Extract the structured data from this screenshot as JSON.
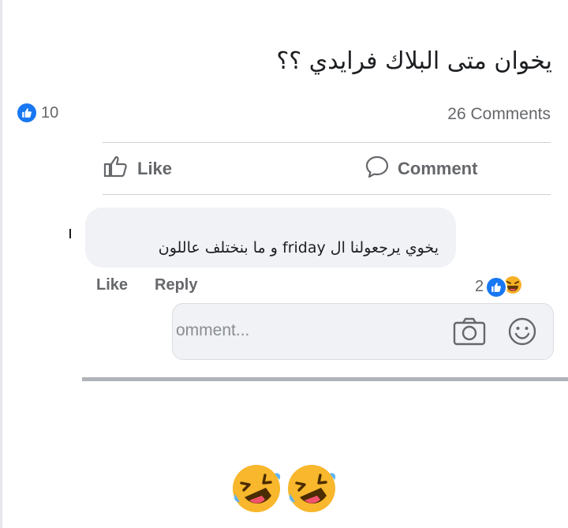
{
  "post": {
    "text": "يخوان متى البلاك فرايدي ؟؟"
  },
  "stats": {
    "reaction_count": "10",
    "comments_label": "26 Comments"
  },
  "actions": {
    "like_label": "Like",
    "comment_label": "Comment"
  },
  "comment": {
    "text": "يخوي يرجعولنا ال friday و ما بنختلف عاللون",
    "like_label": "Like",
    "reply_label": "Reply",
    "reaction_count": "2"
  },
  "composer": {
    "placeholder": "omment..."
  },
  "colors": {
    "brand": "#1877f2",
    "muted": "#65676b",
    "bubble": "#f0f2f5"
  },
  "icons": [
    "like-badge-icon",
    "thumbs-up-outline-icon",
    "comment-bubble-icon",
    "laughing-emoji-icon",
    "camera-icon",
    "smiley-icon",
    "rofl-emoji-icon"
  ]
}
